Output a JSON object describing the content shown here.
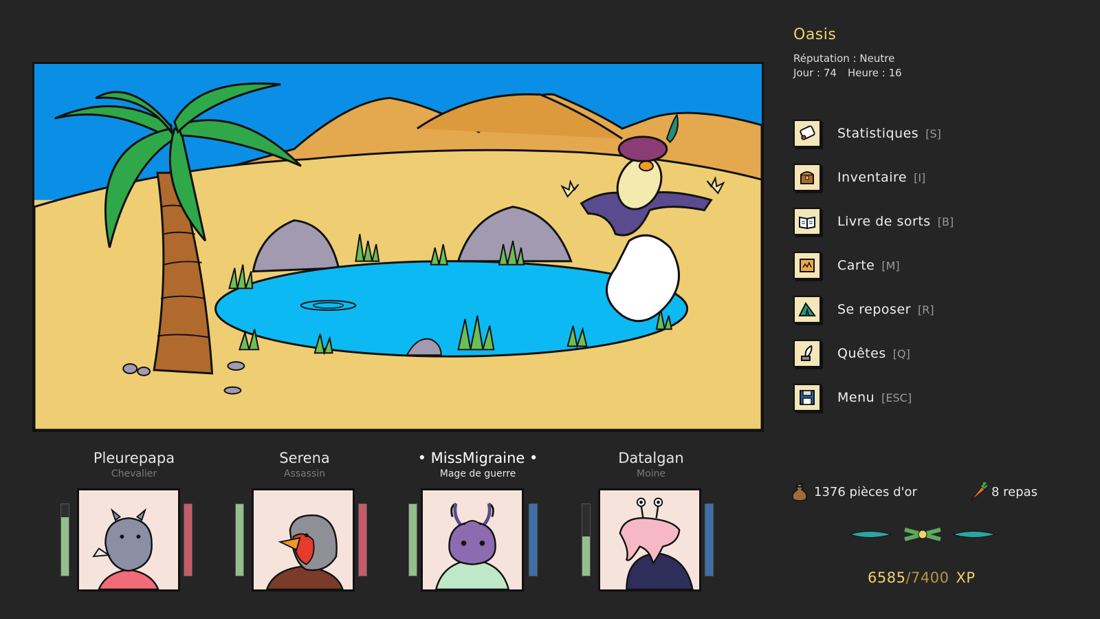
{
  "location": {
    "name": "Oasis",
    "reputation": "Réputation : Neutre",
    "day": "Jour : 74",
    "hour": "Heure : 16"
  },
  "menu": [
    {
      "label": "Statistiques",
      "key": "[S]",
      "icon": "scroll-icon"
    },
    {
      "label": "Inventaire",
      "key": "[I]",
      "icon": "chest-icon"
    },
    {
      "label": "Livre de sorts",
      "key": "[B]",
      "icon": "spellbook-icon"
    },
    {
      "label": "Carte",
      "key": "[M]",
      "icon": "map-icon"
    },
    {
      "label": "Se reposer",
      "key": "[R]",
      "icon": "tent-icon"
    },
    {
      "label": "Quêtes",
      "key": "[Q]",
      "icon": "quill-icon"
    },
    {
      "label": "Menu",
      "key": "[ESC]",
      "icon": "floppy-disk-icon"
    }
  ],
  "party": [
    {
      "name": "Pleurepapa",
      "class": "Chevalier",
      "active": false,
      "hp": 0.82,
      "resource": 1.0,
      "resource_color": "#c75b6a",
      "portrait": "rhino"
    },
    {
      "name": "Serena",
      "class": "Assassin",
      "active": false,
      "hp": 1.0,
      "resource": 1.0,
      "resource_color": "#c75b6a",
      "portrait": "robin"
    },
    {
      "name": "• MissMigraine •",
      "class": "Mage de guerre",
      "active": true,
      "hp": 1.0,
      "resource": 1.0,
      "resource_color": "#3f6fa8",
      "portrait": "beetle"
    },
    {
      "name": "Datalgan",
      "class": "Moine",
      "active": false,
      "hp": 0.55,
      "resource": 1.0,
      "resource_color": "#3f6fa8",
      "portrait": "slug"
    }
  ],
  "resources": {
    "gold": "1376 pièces d'or",
    "meals": "8 repas"
  },
  "xp": {
    "current": "6585",
    "separator": "/",
    "max": "7400",
    "unit": "XP"
  },
  "colors": {
    "background": "#252525",
    "accent_gold": "#f2d16e",
    "sky": "#0b8fe6",
    "sand": "#efce73",
    "water": "#0db9f2"
  }
}
